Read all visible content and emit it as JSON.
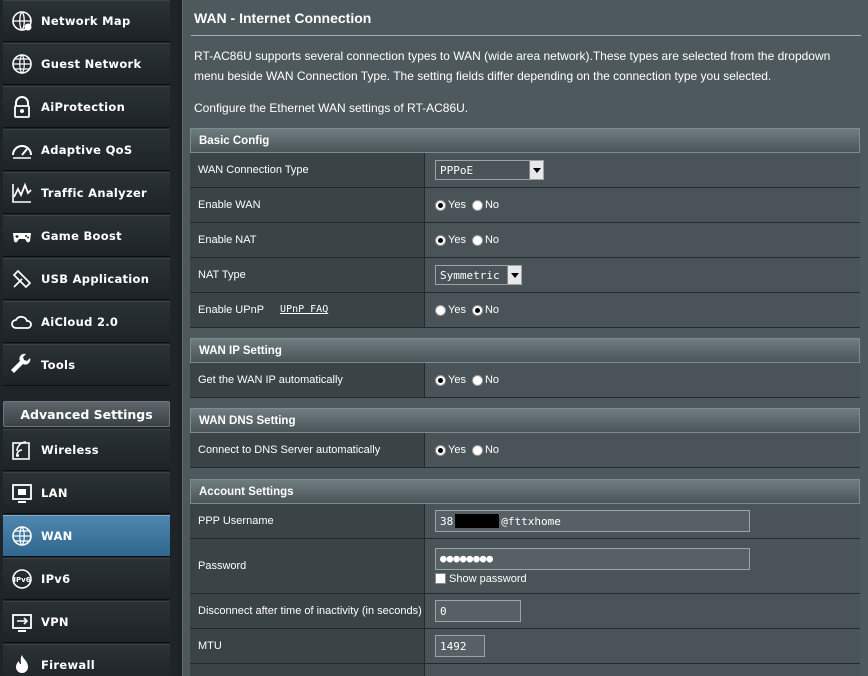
{
  "sidebar": {
    "items": [
      {
        "label": "Network Map",
        "icon": "network-map-icon"
      },
      {
        "label": "Guest Network",
        "icon": "globe-icon"
      },
      {
        "label": "AiProtection",
        "icon": "lock-icon"
      },
      {
        "label": "Adaptive QoS",
        "icon": "speedometer-icon"
      },
      {
        "label": "Traffic Analyzer",
        "icon": "chart-icon"
      },
      {
        "label": "Game Boost",
        "icon": "gamepad-icon"
      },
      {
        "label": "USB Application",
        "icon": "puzzle-icon"
      },
      {
        "label": "AiCloud 2.0",
        "icon": "cloud-icon"
      },
      {
        "label": "Tools",
        "icon": "wrench-icon"
      }
    ],
    "advanced_header": "Advanced Settings",
    "advanced_items": [
      {
        "label": "Wireless",
        "icon": "wifi-icon"
      },
      {
        "label": "LAN",
        "icon": "lan-icon"
      },
      {
        "label": "WAN",
        "icon": "globe-icon",
        "active": true
      },
      {
        "label": "IPv6",
        "icon": "ipv6-icon"
      },
      {
        "label": "VPN",
        "icon": "vpn-icon"
      },
      {
        "label": "Firewall",
        "icon": "fire-icon"
      }
    ]
  },
  "page": {
    "title": "WAN - Internet Connection",
    "description": "RT-AC86U supports several connection types to WAN (wide area network).These types are selected from the dropdown menu beside WAN Connection Type. The setting fields differ depending on the connection type you selected.",
    "description2": "Configure the Ethernet WAN settings of RT-AC86U."
  },
  "basic": {
    "header": "Basic Config",
    "wan_type_label": "WAN Connection Type",
    "wan_type_value": "PPPoE",
    "enable_wan_label": "Enable WAN",
    "enable_nat_label": "Enable NAT",
    "nat_type_label": "NAT Type",
    "nat_type_value": "Symmetric",
    "upnp_label": "Enable UPnP",
    "upnp_faq": "UPnP FAQ",
    "yes": "Yes",
    "no": "No"
  },
  "wan_ip": {
    "header": "WAN IP Setting",
    "auto_label": "Get the WAN IP automatically"
  },
  "wan_dns": {
    "header": "WAN DNS Setting",
    "auto_label": "Connect to DNS Server automatically"
  },
  "account": {
    "header": "Account Settings",
    "username_label": "PPP Username",
    "username_prefix": "38",
    "username_suffix": "@fttxhome",
    "password_label": "Password",
    "password_value": "●●●●●●●●",
    "show_password": "Show password",
    "idle_label": "Disconnect after time of inactivity (in seconds)",
    "idle_value": "0",
    "mtu_label": "MTU",
    "mtu_value": "1492"
  },
  "colors": {
    "active_nav": "#3d77a0",
    "panel_bg": "#4d595d",
    "sidebar_bg": "#1e2428"
  }
}
